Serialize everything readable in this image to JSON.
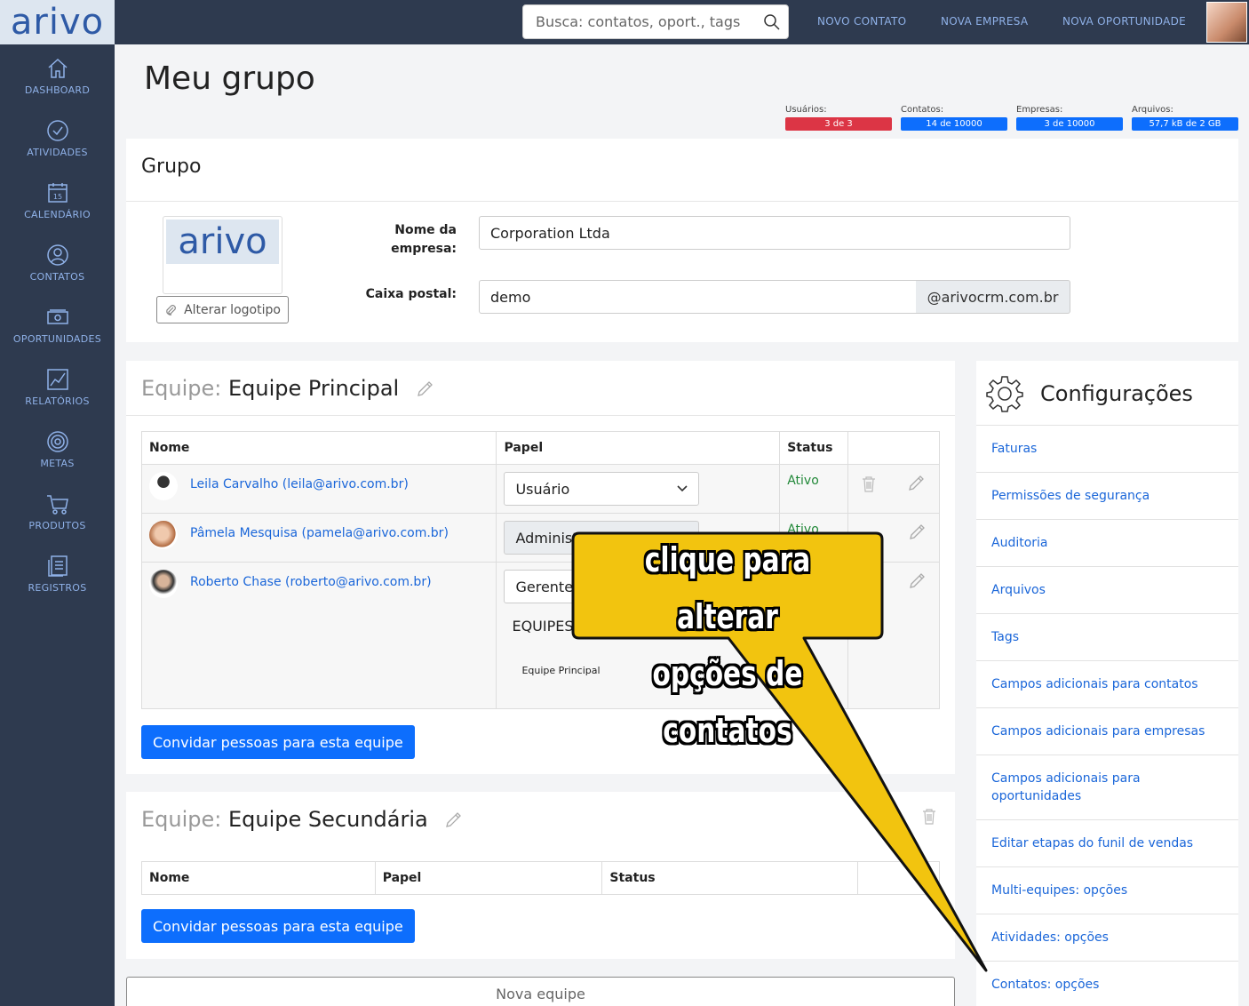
{
  "brand": {
    "logo_text": "arivo"
  },
  "sidebar": {
    "items": [
      {
        "label": "DASHBOARD",
        "icon": "home-icon"
      },
      {
        "label": "ATIVIDADES",
        "icon": "check-circle-icon"
      },
      {
        "label": "CALENDÁRIO",
        "icon": "calendar-icon",
        "day": "15"
      },
      {
        "label": "CONTATOS",
        "icon": "user-icon"
      },
      {
        "label": "OPORTUNIDADES",
        "icon": "money-icon"
      },
      {
        "label": "RELATÓRIOS",
        "icon": "chart-icon"
      },
      {
        "label": "METAS",
        "icon": "target-icon"
      },
      {
        "label": "PRODUTOS",
        "icon": "cart-icon"
      },
      {
        "label": "REGISTROS",
        "icon": "records-icon"
      }
    ]
  },
  "topbar": {
    "search_placeholder": "Busca: contatos, oport., tags",
    "links": [
      "NOVO CONTATO",
      "NOVA EMPRESA",
      "NOVA OPORTUNIDADE"
    ]
  },
  "page": {
    "title": "Meu grupo"
  },
  "usage": [
    {
      "label": "Usuários:",
      "value": "3 de 3",
      "color": "#dc3545"
    },
    {
      "label": "Contatos:",
      "value": "14 de 10000",
      "color": "#0d6efd"
    },
    {
      "label": "Empresas:",
      "value": "3 de 10000",
      "color": "#0d6efd"
    },
    {
      "label": "Arquivos:",
      "value": "57,7 kB de 2 GB",
      "color": "#0d6efd"
    }
  ],
  "group": {
    "title": "Grupo",
    "logo_text": "arivo",
    "change_logo_label": "Alterar logotipo",
    "company_name_label_1": "Nome da",
    "company_name_label_2": "empresa:",
    "company_name_value": "Corporation Ltda",
    "mailbox_label": "Caixa postal:",
    "mailbox_value": "demo",
    "mailbox_domain": "@arivocrm.com.br"
  },
  "team1": {
    "prefix": "Equipe:",
    "name": "Equipe Principal",
    "columns": [
      "Nome",
      "Papel",
      "Status"
    ],
    "members": [
      {
        "name": "Leila Carvalho (leila@arivo.com.br)",
        "role": "Usuário",
        "status": "Ativo"
      },
      {
        "name": "Pâmela Mesquisa (pamela@arivo.com.br)",
        "role": "Administ",
        "status": "Ativo"
      },
      {
        "name": "Roberto Chase (roberto@arivo.com.br)",
        "role": "Gerente",
        "status": ""
      }
    ],
    "teams_heading": "EQUIPES",
    "teams_item": "Equipe Principal",
    "invite_label": "Convidar pessoas para esta equipe"
  },
  "team2": {
    "prefix": "Equipe:",
    "name": "Equipe Secundária",
    "columns": [
      "Nome",
      "Papel",
      "Status"
    ],
    "invite_label": "Convidar pessoas para esta equipe"
  },
  "new_team_label": "Nova equipe",
  "config": {
    "title": "Configurações",
    "items": [
      "Faturas",
      "Permissões de segurança",
      "Auditoria",
      "Arquivos",
      "Tags",
      "Campos adicionais para contatos",
      "Campos adicionais para empresas",
      "Campos adicionais para oportunidades",
      "Editar etapas do funil de vendas",
      "Multi-equipes: opções",
      "Atividades: opções",
      "Contatos: opções"
    ]
  },
  "callout": {
    "line1": "clique para alterar",
    "line2": "opções de contatos",
    "color": "#f2c40f"
  }
}
